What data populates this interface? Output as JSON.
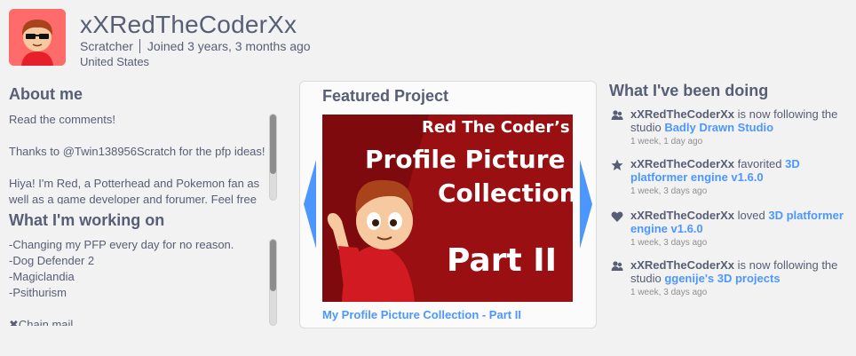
{
  "profile": {
    "username": "xXRedTheCoderXx",
    "role": "Scratcher",
    "joined": "Joined 3 years, 3 months ago",
    "location": "United States"
  },
  "about": {
    "title": "About me",
    "text": "Read the comments!\n\nThanks to @Twin138956Scratch for the pfp ideas!\n\nHiya! I'm Red, a Potterhead and Pokemon fan as well as a game developer and forumer. Feel free"
  },
  "working": {
    "title": "What I'm working on",
    "text": "-Changing my PFP every day for no reason.\n-Dog Defender 2\n-Magiclandia\n-Psithurism\n\n✖Chain mail"
  },
  "featured": {
    "title": "Featured Project",
    "thumbnail_lines": [
      "Red The Coder’s",
      "Profile Picture",
      "Collection",
      "Part II"
    ],
    "project_title": "My Profile Picture Collection - Part II"
  },
  "activity": {
    "title": "What I've been doing",
    "items": [
      {
        "icon": "follow-icon",
        "actor": "xXRedTheCoderXx",
        "action_pre": " is now following the studio ",
        "target": "Badly Drawn Studio",
        "time": "1 week, 1 day ago"
      },
      {
        "icon": "star-icon",
        "actor": "xXRedTheCoderXx",
        "action_pre": " favorited ",
        "target": "3D platformer engine v1.6.0",
        "time": "1 week, 3 days ago"
      },
      {
        "icon": "heart-icon",
        "actor": "xXRedTheCoderXx",
        "action_pre": " loved ",
        "target": "3D platformer engine v1.6.0",
        "time": "1 week, 3 days ago"
      },
      {
        "icon": "follow-icon",
        "actor": "xXRedTheCoderXx",
        "action_pre": " is now following the studio ",
        "target": "ggenije's 3D projects",
        "time": "1 week, 3 days ago"
      }
    ]
  },
  "colors": {
    "accent": "#4c97ff",
    "text": "#575e75",
    "thumbnail_bg": "#9a0f12"
  }
}
